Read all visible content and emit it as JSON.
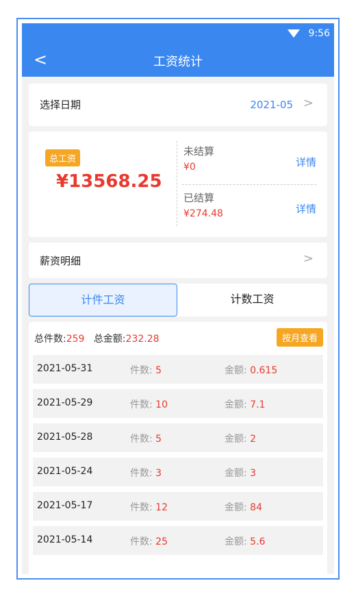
{
  "status_bar": {
    "time": "9:56",
    "wifi_icon": "wifi-icon"
  },
  "app_bar": {
    "back_icon": "back-arrow-icon",
    "back_glyph": "<",
    "title": "工资统计"
  },
  "date_select": {
    "label": "选择日期",
    "value": "2021-05",
    "chevron": ">"
  },
  "summary": {
    "total_badge": "总工资",
    "total_amount": "¥13568.25",
    "unsettled": {
      "label": "未结算",
      "amount": "¥0",
      "detail": "详情"
    },
    "settled": {
      "label": "已结算",
      "amount": "¥274.48",
      "detail": "详情"
    }
  },
  "salary_detail": {
    "label": "薪资明细",
    "chevron": ">"
  },
  "tabs": [
    {
      "label": "计件工资",
      "active": true
    },
    {
      "label": "计数工资",
      "active": false
    }
  ],
  "list_summary": {
    "count_label": "总件数:",
    "count_value": "259",
    "amount_label": "总金额:",
    "amount_value": "232.28",
    "month_button": "按月查看"
  },
  "row_labels": {
    "count": "件数: ",
    "amount": "金额: "
  },
  "records": [
    {
      "date": "2021-05-31",
      "count": "5",
      "amount": "0.615"
    },
    {
      "date": "2021-05-29",
      "count": "10",
      "amount": "7.1"
    },
    {
      "date": "2021-05-28",
      "count": "5",
      "amount": "2"
    },
    {
      "date": "2021-05-24",
      "count": "3",
      "amount": "3"
    },
    {
      "date": "2021-05-17",
      "count": "12",
      "amount": "84"
    },
    {
      "date": "2021-05-14",
      "count": "25",
      "amount": "5.6"
    }
  ],
  "colors": {
    "primary": "#3b87f0",
    "accent": "#f5a623",
    "value_red": "#e8392f"
  }
}
